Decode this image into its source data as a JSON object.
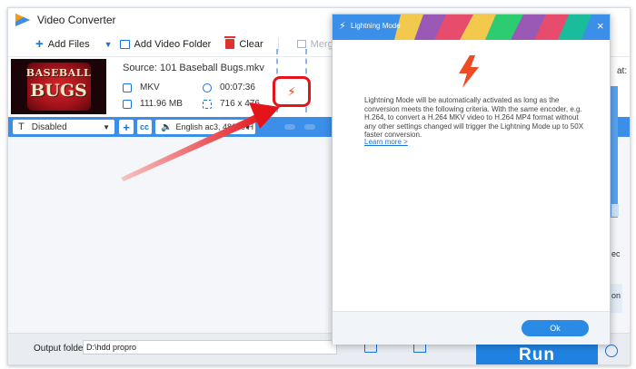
{
  "app": {
    "title": "Video Converter"
  },
  "toolbar": {
    "add_files": "Add Files",
    "add_video_folder": "Add Video Folder",
    "clear": "Clear",
    "merge": "Merge"
  },
  "file": {
    "thumbnail_text_line1": "BASEBALL",
    "thumbnail_text_line2": "BUGS",
    "source": "Source: 101 Baseball Bugs.mkv",
    "format": "MKV",
    "duration": "00:07:36",
    "size": "111.96 MB",
    "resolution": "716 x 476"
  },
  "subtitle_bar": {
    "subtitle_value": "Disabled",
    "audio_value": "English ac3, 48000 H"
  },
  "right_panel": {
    "format_label_partial": "at:",
    "ec_partial": "ec",
    "on_partial": "on"
  },
  "bottom": {
    "output_folder_label": "Output folder:",
    "output_folder_path": "D:\\hdd propro",
    "run_label": "Run"
  },
  "dialog": {
    "title": "Lightning Mode",
    "close": "×",
    "body": "Lightning Mode will be automatically activated as long as the conversion meets the following criteria. With the same encoder, e.g. H.264, to convert a H.264 MKV video to H.264 MP4 format without any other settings changed will trigger the Lightning Mode up to 50X faster conversion.",
    "learn_more": "Learn more >",
    "ok": "Ok"
  },
  "colors": {
    "accent_blue": "#3b8fe8",
    "lightning_orange": "#ef4a23",
    "highlight_red": "#e3151b"
  }
}
